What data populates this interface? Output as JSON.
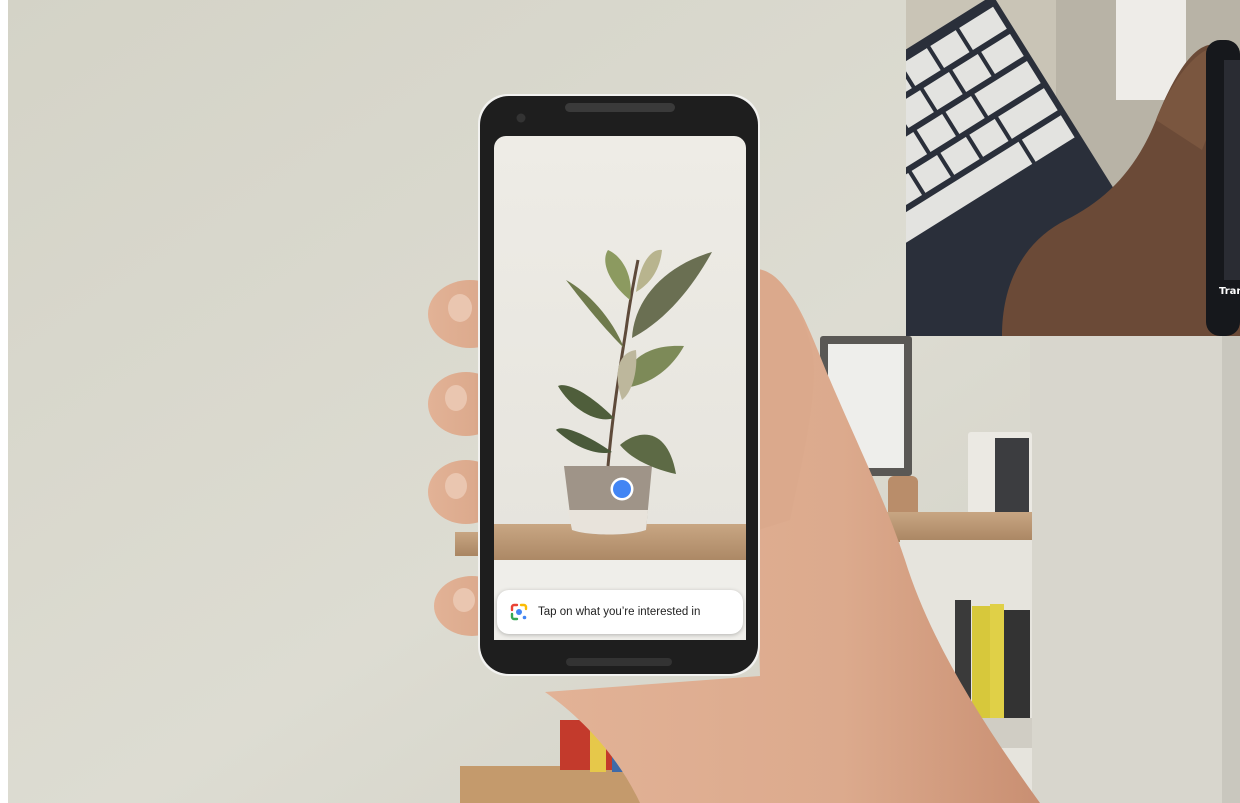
{
  "lens": {
    "prompt_text": "Tap on what you’re interested in",
    "icon": "google-lens-icon",
    "accent_colors": [
      "#4285F4",
      "#EA4335",
      "#FBBC05",
      "#34A853"
    ]
  },
  "focus_indicator": {
    "icon": "focus-dot-icon",
    "color": "#4285F4"
  },
  "inset": {
    "caption_fragment": "Tran"
  }
}
